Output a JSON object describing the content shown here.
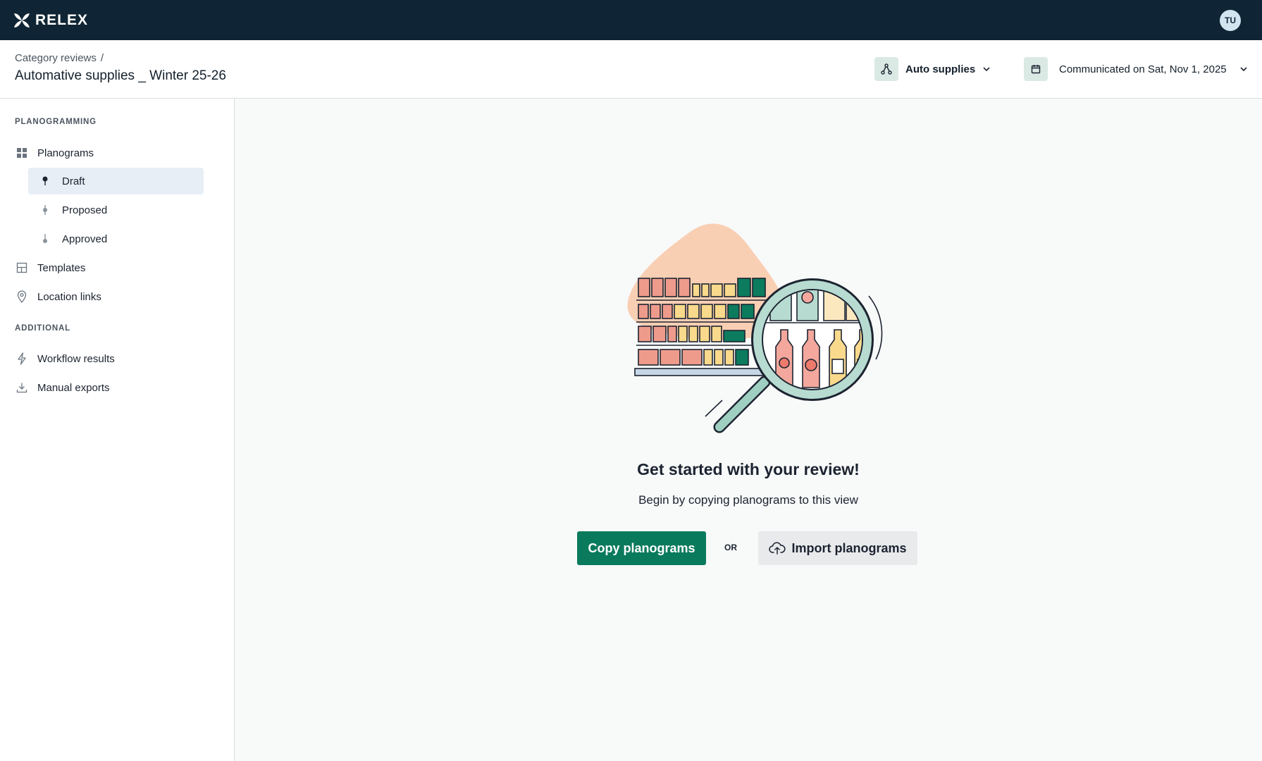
{
  "topbar": {
    "brand": "RELEX",
    "avatar_initials": "TU"
  },
  "header": {
    "breadcrumb_parent": "Category reviews",
    "breadcrumb_separator": "/",
    "title": "Automative supplies _ Winter 25-26",
    "hierarchy_label": "Auto supplies",
    "date_label": "Communicated on Sat, Nov 1, 2025"
  },
  "sidebar": {
    "section_planogramming": "PLANOGRAMMING",
    "planograms": "Planograms",
    "draft": "Draft",
    "proposed": "Proposed",
    "approved": "Approved",
    "templates": "Templates",
    "location_links": "Location links",
    "section_additional": "ADDITIONAL",
    "workflow_results": "Workflow results",
    "manual_exports": "Manual exports"
  },
  "empty_state": {
    "title": "Get started with your review!",
    "subtitle": "Begin by copying planograms to this view",
    "copy_button": "Copy planograms",
    "or_label": "OR",
    "import_button": "Import planograms"
  },
  "colors": {
    "topbar": "#0f2535",
    "primary": "#0a7a5d",
    "active_nav": "#e7eef5"
  }
}
